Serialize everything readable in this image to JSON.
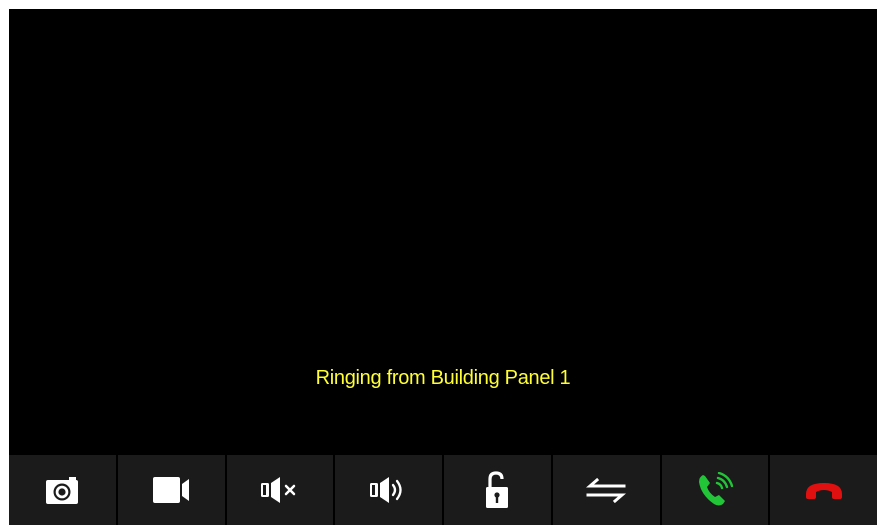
{
  "call": {
    "status_text": "Ringing from Building Panel 1"
  },
  "toolbar": {
    "buttons": [
      {
        "name": "snapshot-button",
        "icon": "camera-icon"
      },
      {
        "name": "record-button",
        "icon": "video-camera-icon"
      },
      {
        "name": "mute-button",
        "icon": "speaker-mute-icon"
      },
      {
        "name": "volume-button",
        "icon": "speaker-volume-icon"
      },
      {
        "name": "unlock-button",
        "icon": "unlock-icon"
      },
      {
        "name": "transfer-button",
        "icon": "transfer-arrows-icon"
      },
      {
        "name": "answer-button",
        "icon": "answer-phone-icon"
      },
      {
        "name": "hangup-button",
        "icon": "hangup-phone-icon"
      }
    ]
  },
  "colors": {
    "background": "#000000",
    "toolbar_button": "#1b1b1b",
    "status_text": "#ffff33",
    "icon": "#ffffff",
    "answer": "#22c538",
    "hangup": "#e01010"
  }
}
